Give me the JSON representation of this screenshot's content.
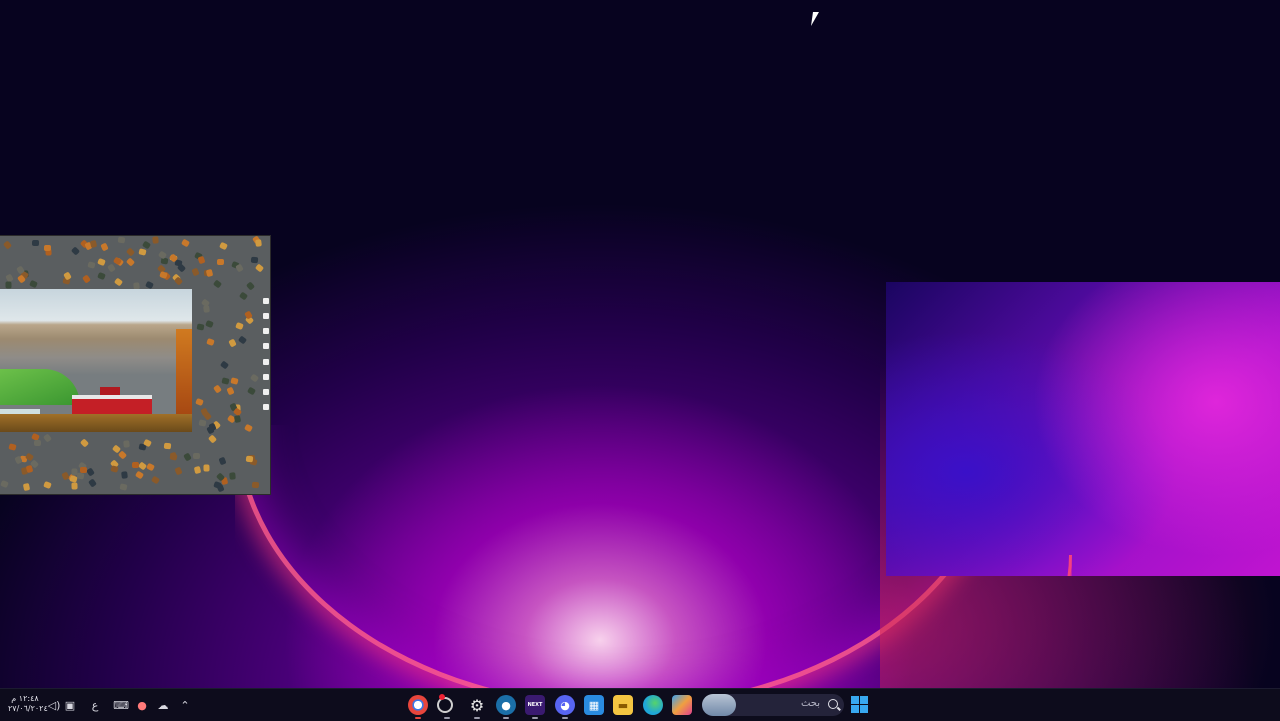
{
  "taskbar": {
    "clock": {
      "time": "١٢:٤٨ م",
      "date": "٢٧/٠٦/٢٠٢٤"
    },
    "tray": {
      "language": "ع",
      "volume_icon": "speaker-icon",
      "network_icon": "network-icon",
      "keyboard_icon": "keyboard-icon",
      "mic_icon": "microphone-icon",
      "cloud_icon": "cloud-icon",
      "overflow_icon": "chevron-up-icon"
    },
    "apps": [
      {
        "name": "chrome-icon",
        "color": "#e8453c"
      },
      {
        "name": "update-icon",
        "color": "#cfcfcf"
      },
      {
        "name": "settings-icon",
        "color": "#e0e0e0"
      },
      {
        "name": "steam-icon",
        "color": "#1b6fa8"
      },
      {
        "name": "next-icon",
        "label": "NEXT",
        "color": "#7a2bd0"
      },
      {
        "name": "discord-icon",
        "color": "#5865f2"
      },
      {
        "name": "store-icon",
        "color": "#2a8be0"
      },
      {
        "name": "file-explorer-icon",
        "color": "#f4c542"
      },
      {
        "name": "edge-icon",
        "color": "#1fa6d8"
      },
      {
        "name": "copilot-icon",
        "color": "#f0a040"
      }
    ],
    "search": {
      "placeholder": "بحث"
    },
    "start_icon": "windows-start-icon"
  },
  "accent": {
    "bloom_pink": "#ff5a8c",
    "bloom_purple": "#9a10c8",
    "taskbar_bg": "#0d0c1c"
  },
  "puzzle_window": {
    "toolbar_icons": [
      "grid-icon",
      "box-icon",
      "rotate-icon",
      "zoom-icon",
      "image-icon",
      "edge-icon",
      "menu-icon",
      "arrow-right-icon"
    ]
  }
}
